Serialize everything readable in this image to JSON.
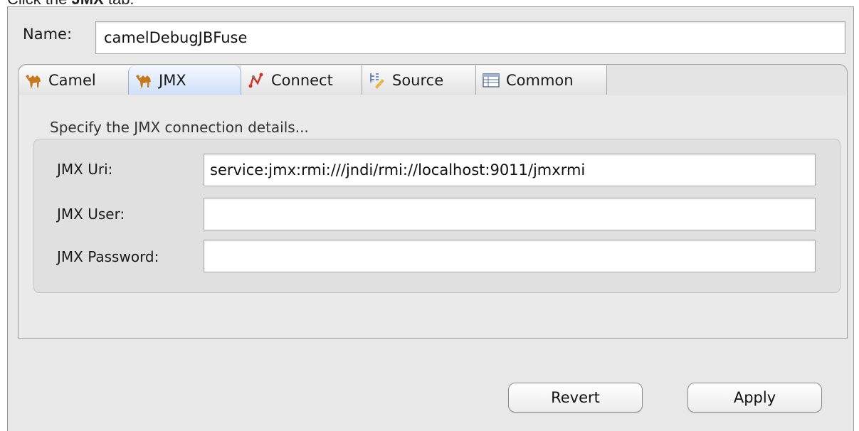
{
  "instruction": {
    "prefix": "Click the ",
    "bold": "JMX",
    "suffix": " tab."
  },
  "name": {
    "label": "Name:",
    "value": "camelDebugJBFuse"
  },
  "tabs": [
    {
      "label": "Camel",
      "icon": "camel-icon",
      "selected": false
    },
    {
      "label": "JMX",
      "icon": "camel-icon",
      "selected": true
    },
    {
      "label": "Connect",
      "icon": "connect-icon",
      "selected": false
    },
    {
      "label": "Source",
      "icon": "source-icon",
      "selected": false
    },
    {
      "label": "Common",
      "icon": "common-icon",
      "selected": false
    }
  ],
  "jmx_panel": {
    "title": "Specify the JMX connection details...",
    "fields": [
      {
        "label": "JMX Uri:",
        "value": "service:jmx:rmi:///jndi/rmi://localhost:9011/jmxrmi"
      },
      {
        "label": "JMX User:",
        "value": ""
      },
      {
        "label": "JMX Password:",
        "value": ""
      }
    ]
  },
  "buttons": {
    "revert": "Revert",
    "apply": "Apply"
  },
  "colors": {
    "selected_tab": "#cfe0f8",
    "camel_icon": "#c8781e",
    "connect_icon": "#d0342c"
  }
}
